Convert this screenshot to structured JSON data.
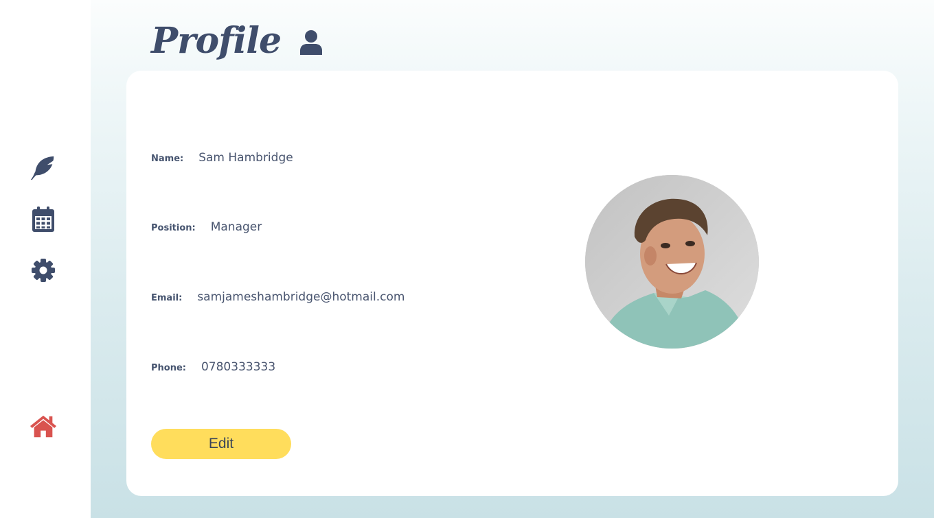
{
  "page": {
    "title": "Profile"
  },
  "sidebar": {
    "items": [
      {
        "icon": "feather-icon",
        "color": "#3f4d6b"
      },
      {
        "icon": "calendar-icon",
        "color": "#3f4d6b"
      },
      {
        "icon": "gear-icon",
        "color": "#3f4d6b"
      },
      {
        "icon": "home-icon",
        "color": "#d9534f"
      }
    ]
  },
  "profile": {
    "fields": [
      {
        "label": "Name:",
        "value": "Sam Hambridge"
      },
      {
        "label": "Position:",
        "value": "Manager"
      },
      {
        "label": "Email:",
        "value": "samjameshambridge@hotmail.com"
      },
      {
        "label": "Phone:",
        "value": "0780333333"
      }
    ],
    "edit_label": "Edit"
  },
  "colors": {
    "accent": "#ffdd5c",
    "text": "#3f4d6b",
    "home": "#d9534f"
  }
}
